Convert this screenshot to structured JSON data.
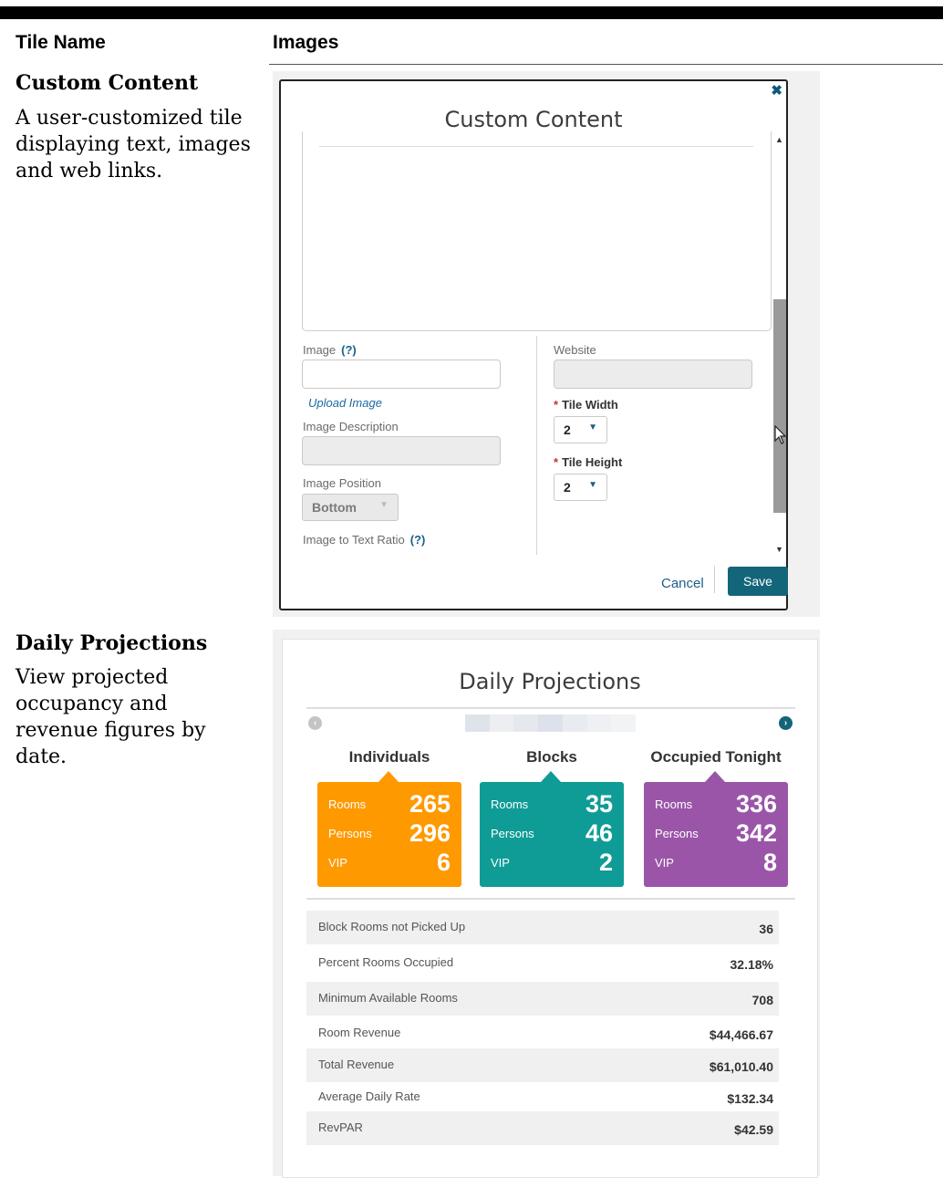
{
  "table": {
    "headers": [
      "Tile Name",
      "Images"
    ],
    "rows": [
      {
        "name": "Custom Content",
        "description": "A user-customized tile displaying text, images and web links."
      },
      {
        "name": "Daily Projections",
        "description": "View projected occupancy and revenue figures by date."
      }
    ]
  },
  "custom_content": {
    "close_icon": "x-icon",
    "title": "Custom Content",
    "image_label": "Image",
    "help": "(?)",
    "upload_link": "Upload Image",
    "image_description_label": "Image Description",
    "image_position_label": "Image Position",
    "image_position_value": "Bottom",
    "ratio_label": "Image to Text Ratio",
    "website_label": "Website",
    "required_mark": "*",
    "tile_width_label": "Tile Width",
    "tile_width_value": "2",
    "tile_height_label": "Tile Height",
    "tile_height_value": "2",
    "cancel_label": "Cancel",
    "save_label": "Save",
    "accent_color": "#13657a"
  },
  "daily_projections": {
    "title": "Daily Projections",
    "prev_icon": "chevron-left-icon",
    "next_icon": "chevron-right-icon",
    "groups": [
      {
        "name": "Individuals",
        "color": "#ff9900",
        "rooms": "265",
        "persons": "296",
        "vip": "6"
      },
      {
        "name": "Blocks",
        "color": "#0f9c96",
        "rooms": "35",
        "persons": "46",
        "vip": "2"
      },
      {
        "name": "Occupied Tonight",
        "color": "#9a55a8",
        "rooms": "336",
        "persons": "342",
        "vip": "8"
      }
    ],
    "row_labels": {
      "rooms": "Rooms",
      "persons": "Persons",
      "vip": "VIP"
    },
    "stats": [
      {
        "label": "Block Rooms not Picked Up",
        "value": "36"
      },
      {
        "label": "Percent Rooms Occupied",
        "value": "32.18%"
      },
      {
        "label": "Minimum Available Rooms",
        "value": "708"
      },
      {
        "label": "Room Revenue",
        "value": "$44,466.67"
      },
      {
        "label": "Total Revenue",
        "value": "$61,010.40"
      },
      {
        "label": "Average Daily Rate",
        "value": "$132.34"
      },
      {
        "label": "RevPAR",
        "value": "$42.59"
      }
    ]
  }
}
